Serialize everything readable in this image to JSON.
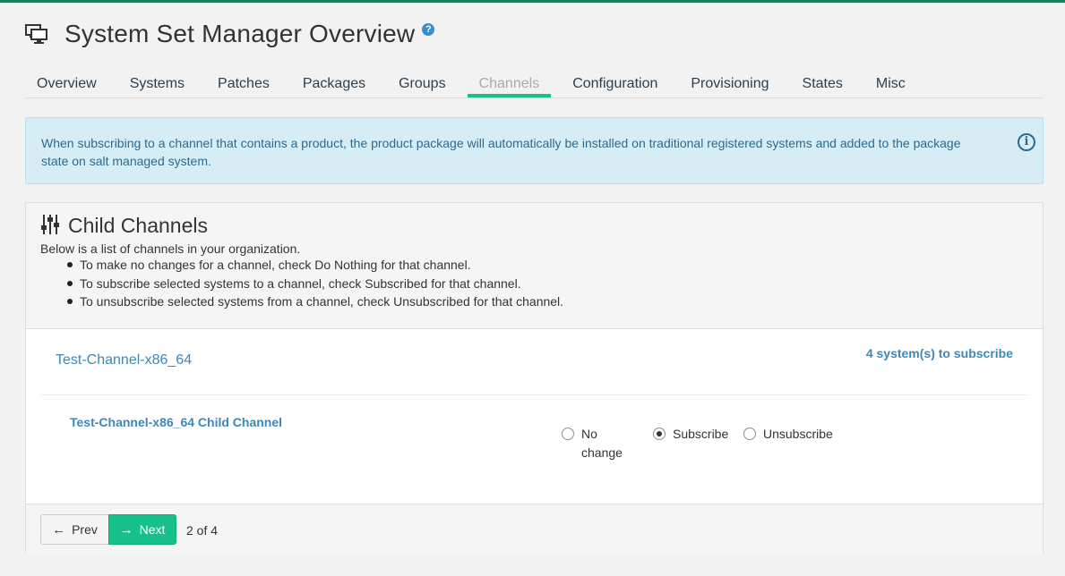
{
  "header": {
    "title": "System Set Manager Overview",
    "help_icon": "question-circle-icon",
    "page_icon": "desktop-systems-icon"
  },
  "tabs": [
    {
      "label": "Overview",
      "active": false
    },
    {
      "label": "Systems",
      "active": false
    },
    {
      "label": "Patches",
      "active": false
    },
    {
      "label": "Packages",
      "active": false
    },
    {
      "label": "Groups",
      "active": false
    },
    {
      "label": "Channels",
      "active": true
    },
    {
      "label": "Configuration",
      "active": false
    },
    {
      "label": "Provisioning",
      "active": false
    },
    {
      "label": "States",
      "active": false
    },
    {
      "label": "Misc",
      "active": false
    }
  ],
  "alert": {
    "text": "When subscribing to a channel that contains a product, the product package will automatically be installed on traditional registered systems and added to the package state on salt managed system.",
    "icon": "info-circle-icon"
  },
  "panel": {
    "title": "Child Channels",
    "icon": "sliders-icon",
    "description": "Below is a list of channels in your organization.",
    "bullets": [
      "To make no changes for a channel, check Do Nothing for that channel.",
      "To subscribe selected systems to a channel, check Subscribed for that channel.",
      "To unsubscribe selected systems from a channel, check Unsubscribed for that channel."
    ],
    "base_channel": "Test-Channel-x86_64",
    "subscribe_count": "4 system(s) to subscribe",
    "child_channel": "Test-Channel-x86_64 Child Channel",
    "options": {
      "no_change_line1": "No",
      "no_change_line2": "change",
      "subscribe": "Subscribe",
      "unsubscribe": "Unsubscribe",
      "selected": "subscribe"
    }
  },
  "footer": {
    "prev_label": "Prev",
    "next_label": "Next",
    "page_count": "2 of 4"
  },
  "colors": {
    "accent": "#16c08a",
    "link": "#3e87b7",
    "alert_bg": "#d6edf6",
    "alert_text": "#2d6a8e",
    "top_bar": "#1e7a5a"
  }
}
